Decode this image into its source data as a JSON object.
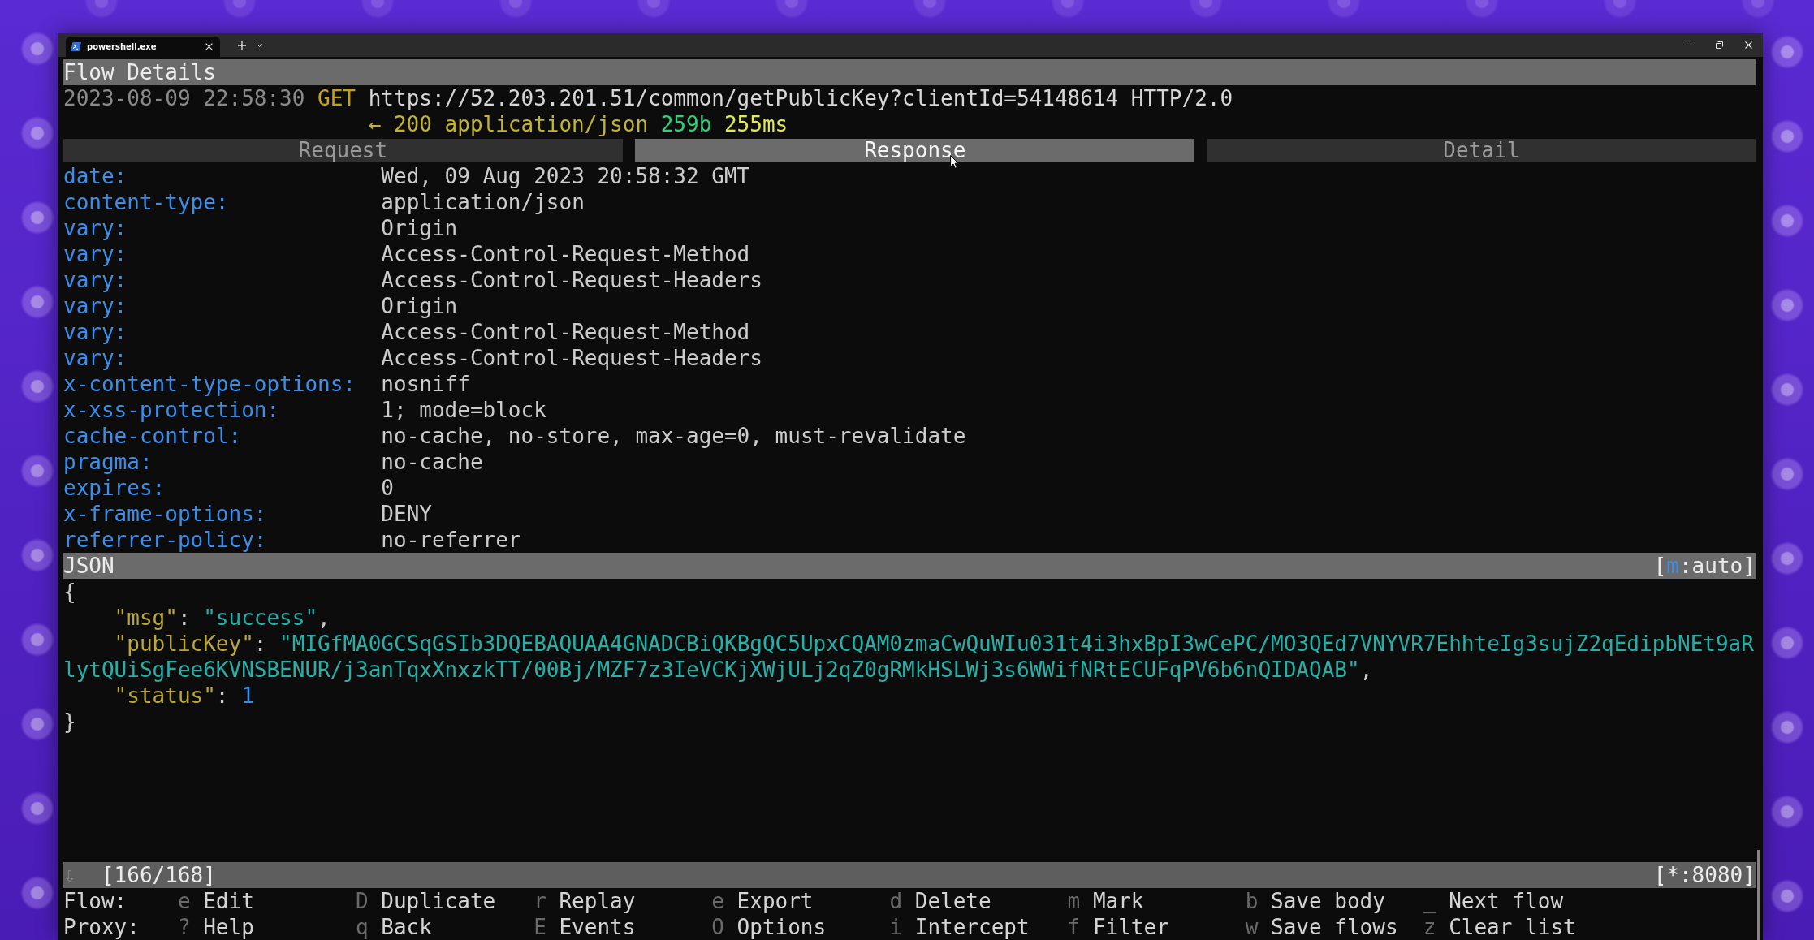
{
  "window": {
    "tabs": [
      {
        "title": "powershell.exe",
        "selected": true
      }
    ]
  },
  "flow": {
    "title": "Flow Details",
    "request": {
      "timestamp": "2023-08-09 22:58:30",
      "method": "GET",
      "url": "https://52.203.201.51/common/getPublicKey?clientId=54148614 HTTP/2.0"
    },
    "response": {
      "arrow": "←",
      "status": "200",
      "content_type": "application/json",
      "size": "259b",
      "duration": "255ms"
    },
    "tabs": [
      {
        "label": "Request",
        "selected": false
      },
      {
        "label": "Response",
        "selected": true
      },
      {
        "label": "Detail",
        "selected": false
      }
    ],
    "headers": [
      {
        "name": "date:",
        "value": "Wed, 09 Aug 2023 20:58:32 GMT"
      },
      {
        "name": "content-type:",
        "value": "application/json"
      },
      {
        "name": "vary:",
        "value": "Origin"
      },
      {
        "name": "vary:",
        "value": "Access-Control-Request-Method"
      },
      {
        "name": "vary:",
        "value": "Access-Control-Request-Headers"
      },
      {
        "name": "vary:",
        "value": "Origin"
      },
      {
        "name": "vary:",
        "value": "Access-Control-Request-Method"
      },
      {
        "name": "vary:",
        "value": "Access-Control-Request-Headers"
      },
      {
        "name": "x-content-type-options:",
        "value": "nosniff"
      },
      {
        "name": "x-xss-protection:",
        "value": "1; mode=block"
      },
      {
        "name": "cache-control:",
        "value": "no-cache, no-store, max-age=0, must-revalidate"
      },
      {
        "name": "pragma:",
        "value": "no-cache"
      },
      {
        "name": "expires:",
        "value": "0"
      },
      {
        "name": "x-frame-options:",
        "value": "DENY"
      },
      {
        "name": "referrer-policy:",
        "value": "no-referrer"
      }
    ]
  },
  "body": {
    "title": "JSON",
    "view_mode": [
      {
        "kind": "text",
        "text": "["
      },
      {
        "kind": "key",
        "text": "m"
      },
      {
        "kind": "text",
        "text": ":auto]"
      }
    ],
    "open": "{",
    "members": [
      {
        "key": "\"msg\"",
        "colon": ":",
        "value": "\"success\"",
        "kind": "string",
        "comma": ","
      },
      {
        "key": "\"publicKey\"",
        "colon": ":",
        "value": "\"MIGfMA0GCSqGSIb3DQEBAQUAA4GNADCBiQKBgQC5UpxCQAM0zmaCwQuWIu031t4i3hxBpI3wCePC/MO3QEd7VNYVR7EhhteIg3sujZ2qEdipbNEt9aRlytQUiSgFee6KVNSBENUR/j3anTqxXnxzkTT/00Bj/MZF7z3IeVCKjXWjULj2qZ0gRMkHSLWj3s6WWifNRtECUFqPV6b6nQIDAQAB\"",
        "kind": "string",
        "comma": ","
      },
      {
        "key": "\"status\"",
        "colon": ":",
        "value": "1",
        "kind": "number"
      }
    ],
    "close": "}"
  },
  "status_bar": {
    "follow": "⇩",
    "position": "[166/168]",
    "listen": "[*:8080]"
  },
  "footer": [
    {
      "label": "Flow:",
      "commands": [
        {
          "key": "e",
          "label": "Edit"
        },
        {
          "key": "D",
          "label": "Duplicate"
        },
        {
          "key": "r",
          "label": "Replay"
        },
        {
          "key": "e",
          "label": "Export"
        },
        {
          "key": "d",
          "label": "Delete"
        },
        {
          "key": "m",
          "label": "Mark"
        },
        {
          "key": "b",
          "label": "Save body"
        },
        {
          "key": "_",
          "label": "Next flow"
        }
      ]
    },
    {
      "label": "Proxy:",
      "commands": [
        {
          "key": "?",
          "label": "Help"
        },
        {
          "key": "q",
          "label": "Back"
        },
        {
          "key": "E",
          "label": "Events"
        },
        {
          "key": "O",
          "label": "Options"
        },
        {
          "key": "i",
          "label": "Intercept"
        },
        {
          "key": "f",
          "label": "Filter"
        },
        {
          "key": "w",
          "label": "Save flows"
        },
        {
          "key": "z",
          "label": "Clear list"
        }
      ]
    }
  ]
}
